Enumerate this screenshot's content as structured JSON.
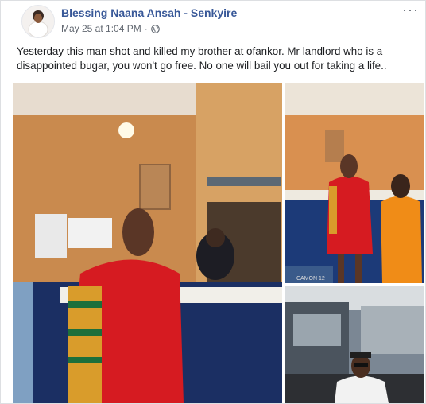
{
  "post": {
    "author": "Blessing Naana Ansah - Senkyire",
    "date": "May 25 at 1:04 PM",
    "separator": "·",
    "privacy_icon": "globe-icon",
    "more_icon": "more-options-icon",
    "text": "Yesterday this man shot and killed my brother at ofankor. Mr landlord who is a disappointed bugar, you won't go free. No one will bail you out for taking a life.."
  },
  "photos": {
    "watermark": "CAMON 12",
    "items": [
      {
        "name": "photo-main",
        "desc": "man in red and kente shirt at counter"
      },
      {
        "name": "photo-top-right",
        "desc": "man in red at reception with officer"
      },
      {
        "name": "photo-bottom-right",
        "desc": "man in cap with sunglasses"
      }
    ]
  },
  "colors": {
    "link": "#385898",
    "meta": "#616770",
    "text": "#1c1e21",
    "border": "#dddfe2"
  }
}
